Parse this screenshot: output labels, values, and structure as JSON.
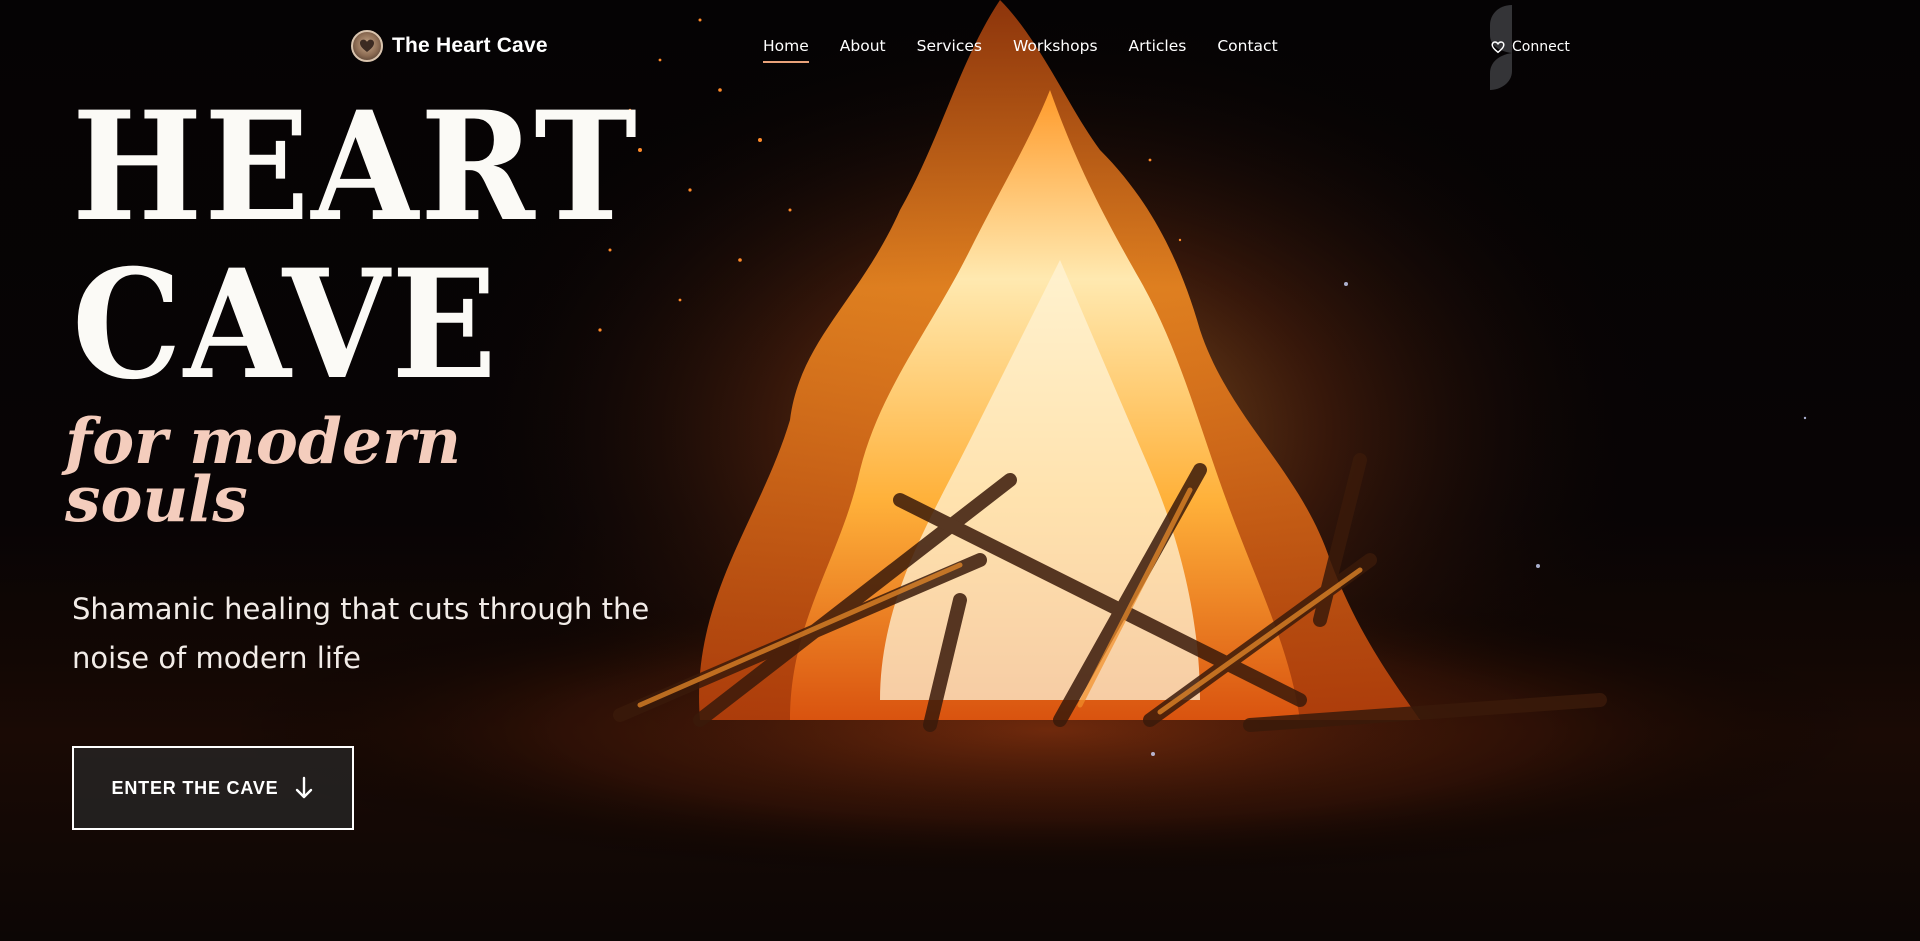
{
  "brand": {
    "name": "The Heart Cave",
    "logo_icon": "heart-logo-icon"
  },
  "nav": {
    "items": [
      {
        "label": "Home",
        "active": true
      },
      {
        "label": "About",
        "active": false
      },
      {
        "label": "Services",
        "active": false
      },
      {
        "label": "Workshops",
        "active": false
      },
      {
        "label": "Articles",
        "active": false
      },
      {
        "label": "Contact",
        "active": false
      }
    ],
    "connect_label": "Connect",
    "connect_icon": "heart-icon"
  },
  "hero": {
    "title_line1": "HEART",
    "title_line2": "CAVE",
    "subtitle_line1": "for modern",
    "subtitle_line2": "souls",
    "description": "Shamanic healing that cuts through the noise of modern life",
    "cta_label": "ENTER THE CAVE",
    "cta_icon": "arrow-down-icon",
    "background_image": "campfire-at-night"
  },
  "colors": {
    "accent": "#e9a27a",
    "subtitle": "#f4cdbd",
    "background": "#050303",
    "text": "#ffffff"
  }
}
